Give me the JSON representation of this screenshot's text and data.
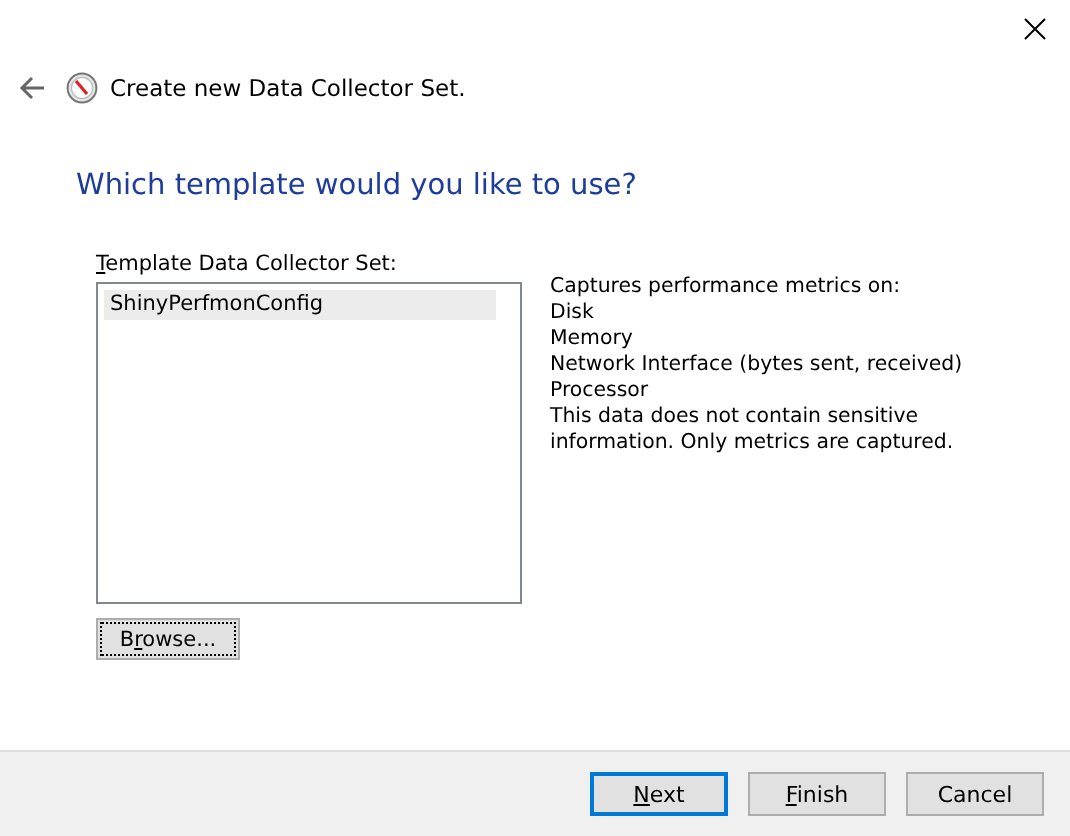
{
  "window": {
    "title": "Create new Data Collector Set."
  },
  "heading": "Which template would you like to use?",
  "template_list": {
    "label": {
      "key": "T",
      "after": "emplate Data Collector Set:"
    },
    "items": [
      {
        "name": "ShinyPerfmonConfig",
        "selected": true
      }
    ]
  },
  "description": {
    "lines": [
      "Captures performance metrics on:",
      "Disk",
      "Memory",
      "Network Interface (bytes sent, received)",
      "Processor"
    ],
    "note": "This data does not contain sensitive information. Only metrics are captured."
  },
  "browse_button": {
    "label": {
      "before": "B",
      "key": "r",
      "after": "owse..."
    },
    "focused": true
  },
  "buttons": [
    {
      "label": {
        "key": "N",
        "after": "ext"
      },
      "default": true
    },
    {
      "label": {
        "key": "F",
        "after": "inish"
      },
      "default": false
    },
    {
      "label": {
        "before": "Cancel"
      },
      "default": false
    }
  ]
}
